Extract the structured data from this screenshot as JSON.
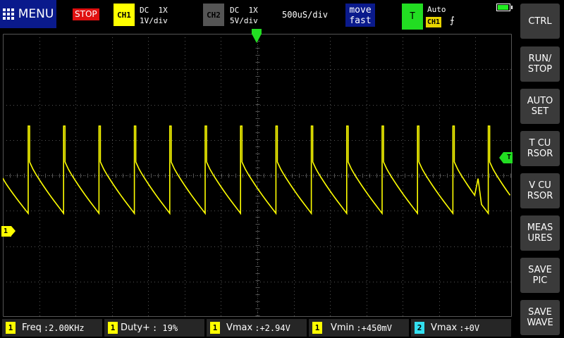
{
  "topbar": {
    "menu_label": "MENU",
    "run_state": "STOP",
    "ch1": {
      "label": "CH1",
      "coupling": "DC  1X",
      "scale": "1V/div",
      "color": "#ffff00"
    },
    "ch2": {
      "label": "CH2",
      "coupling": "DC  1X",
      "scale": "5V/div",
      "color": "#555555"
    },
    "timebase": "500uS/div",
    "move_mode": [
      "move",
      "fast"
    ],
    "trigger": {
      "label": "T",
      "mode": "Auto",
      "source": "CH1",
      "edge": "⨍"
    },
    "battery_level": 0.95
  },
  "screen": {
    "ch1_marker": "1",
    "trigger_level_marker": "T",
    "trace_color": "#ffff00",
    "grid_color": "#555555"
  },
  "side_buttons": [
    {
      "label": "CTRL",
      "active": true
    },
    {
      "label": "RUN/\nSTOP"
    },
    {
      "label": "AUTO\nSET"
    },
    {
      "label": "T CU\nRSOR"
    },
    {
      "label": "V CU\nRSOR"
    },
    {
      "label": "MEAS\nURES"
    },
    {
      "label": "SAVE\nPIC"
    },
    {
      "label": "SAVE\nWAVE"
    }
  ],
  "measurements": [
    {
      "channel": "1",
      "label": "Freq",
      "value": ":2.00KHz"
    },
    {
      "channel": "1",
      "label": "Duty+",
      "value": ": 19%"
    },
    {
      "channel": "1",
      "label": "Vmax",
      "value": ":+2.94V"
    },
    {
      "channel": "1",
      "label": "Vmin",
      "value": ":+450mV"
    },
    {
      "channel": "2",
      "label": "Vmax",
      "value": ":+0V"
    }
  ]
}
